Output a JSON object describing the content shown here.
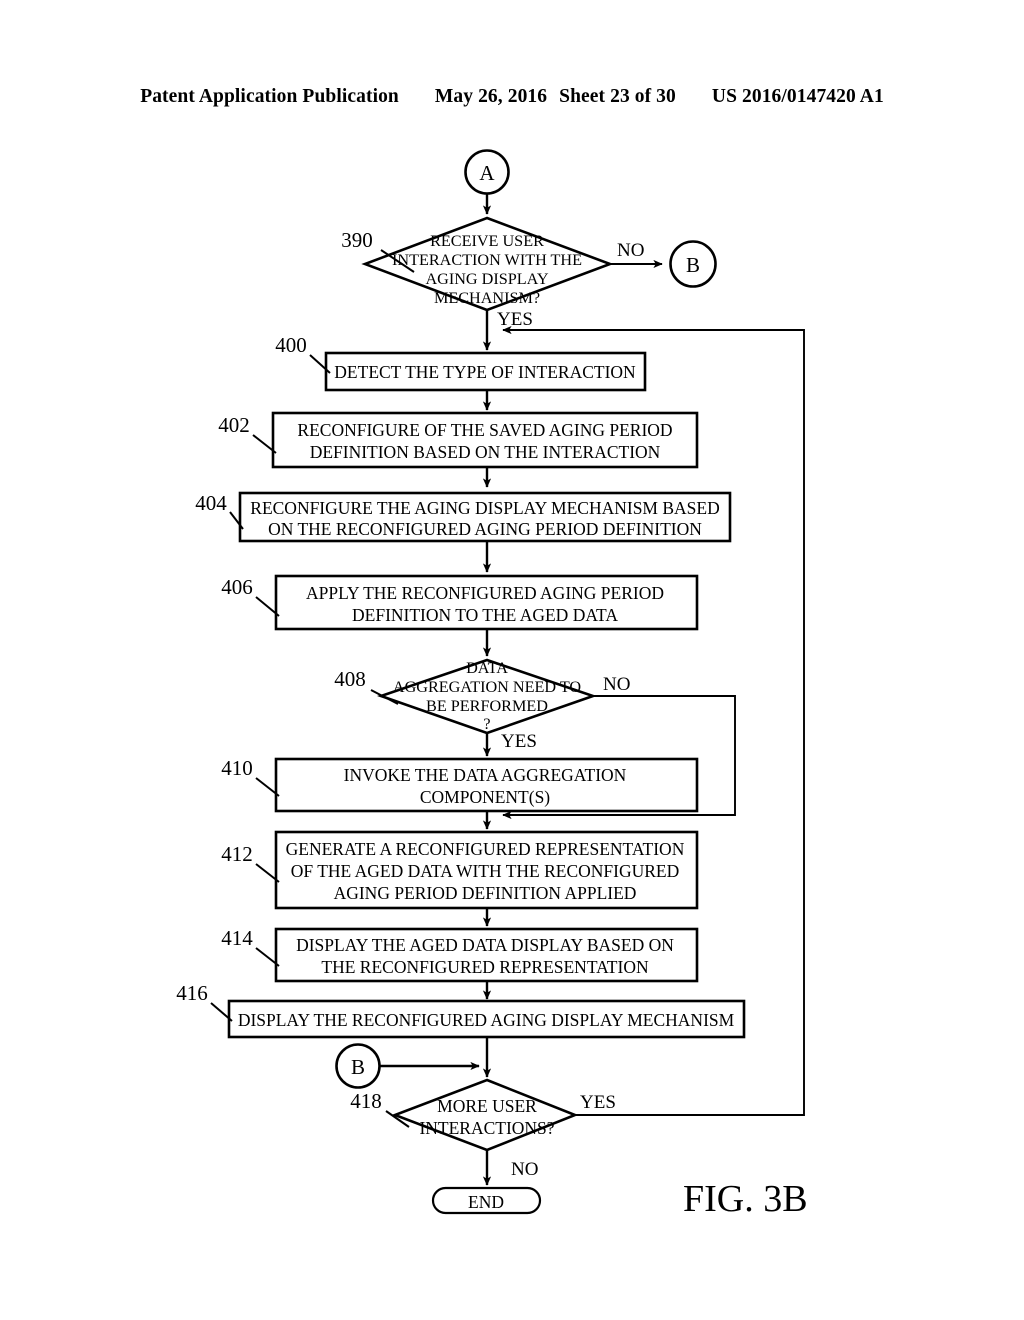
{
  "header": {
    "publication": "Patent Application Publication",
    "date": "May 26, 2016",
    "sheet": "Sheet 23 of 30",
    "patent_number": "US 2016/0147420 A1"
  },
  "figure": {
    "label": "FIG. 3B"
  },
  "connectors": {
    "a_in": "A",
    "b_out": "B",
    "b_in": "B",
    "end": "END"
  },
  "nodes": [
    {
      "ref": "390",
      "type": "decision",
      "lines": [
        "RECEIVE USER",
        "INTERACTION WITH THE",
        "AGING DISPLAY",
        "MECHANISM?"
      ]
    },
    {
      "ref": "400",
      "type": "process",
      "lines": [
        "DETECT THE TYPE OF INTERACTION"
      ]
    },
    {
      "ref": "402",
      "type": "process",
      "lines": [
        "RECONFIGURE OF THE SAVED AGING PERIOD",
        "DEFINITION BASED ON THE INTERACTION"
      ]
    },
    {
      "ref": "404",
      "type": "process",
      "lines": [
        "RECONFIGURE THE AGING DISPLAY MECHANISM BASED",
        "ON THE RECONFIGURED AGING PERIOD DEFINITION"
      ]
    },
    {
      "ref": "406",
      "type": "process",
      "lines": [
        "APPLY THE RECONFIGURED AGING PERIOD",
        "DEFINITION TO THE AGED DATA"
      ]
    },
    {
      "ref": "408",
      "type": "decision",
      "lines": [
        "DATA",
        "AGGREGATION NEED TO",
        "BE PERFORMED",
        "?"
      ]
    },
    {
      "ref": "410",
      "type": "process",
      "lines": [
        "INVOKE THE DATA AGGREGATION",
        "COMPONENT(S)"
      ]
    },
    {
      "ref": "412",
      "type": "process",
      "lines": [
        "GENERATE A RECONFIGURED REPRESENTATION",
        "OF THE AGED DATA WITH THE RECONFIGURED",
        "AGING PERIOD DEFINITION APPLIED"
      ]
    },
    {
      "ref": "414",
      "type": "process",
      "lines": [
        "DISPLAY THE AGED DATA DISPLAY BASED ON",
        "THE RECONFIGURED REPRESENTATION"
      ]
    },
    {
      "ref": "416",
      "type": "process",
      "lines": [
        "DISPLAY THE RECONFIGURED AGING DISPLAY MECHANISM"
      ]
    },
    {
      "ref": "418",
      "type": "decision",
      "lines": [
        "MORE USER",
        "INTERACTIONS?"
      ]
    }
  ],
  "branch_labels": {
    "n390_no": "NO",
    "n390_yes": "YES",
    "n408_no": "NO",
    "n408_yes": "YES",
    "n418_yes": "YES",
    "n418_no": "NO"
  },
  "colors": {
    "ink": "#000000",
    "paper": "#ffffff"
  }
}
